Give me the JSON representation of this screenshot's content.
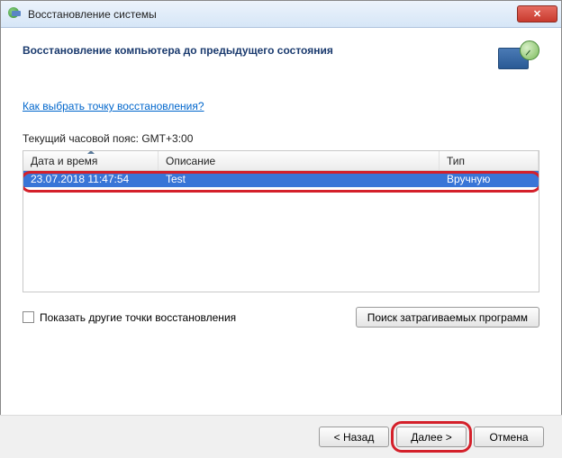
{
  "window": {
    "title": "Восстановление системы"
  },
  "header": {
    "heading": "Восстановление компьютера до предыдущего состояния"
  },
  "link": {
    "text": "Как выбрать точку восстановления?"
  },
  "timezone": {
    "label": "Текущий часовой пояс: GMT+3:00"
  },
  "table": {
    "columns": {
      "datetime": "Дата и время",
      "description": "Описание",
      "type": "Тип"
    },
    "rows": [
      {
        "datetime": "23.07.2018 11:47:54",
        "description": "Test",
        "type": "Вручную"
      }
    ]
  },
  "checkbox": {
    "label": "Показать другие точки восстановления"
  },
  "buttons": {
    "scan": "Поиск затрагиваемых программ",
    "back": "< Назад",
    "next": "Далее >",
    "cancel": "Отмена"
  }
}
